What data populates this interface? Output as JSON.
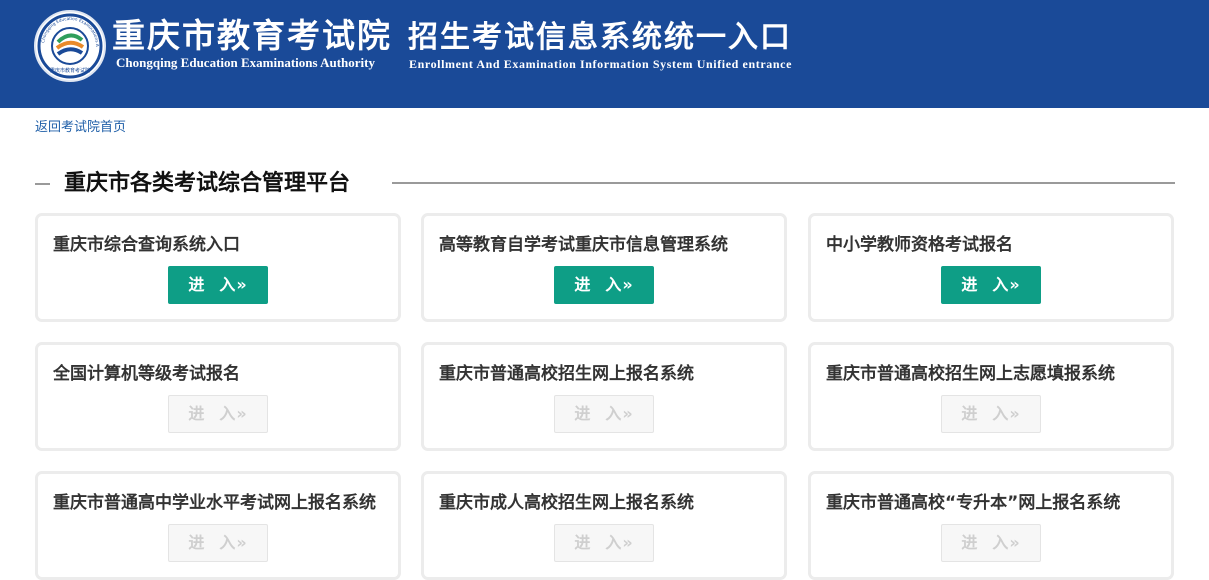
{
  "header": {
    "org_name_cn": "重庆市教育考试院",
    "org_name_en": "Chongqing Education Examinations Authority",
    "system_name_cn": "招生考试信息系统统一入口",
    "system_name_en": "Enrollment And Examination Information System Unified entrance",
    "logo": {
      "ring_text_en": "Chongqing Education Examinations Authority",
      "ring_text_cn": "重庆市教育考试院",
      "colors": {
        "blue": "#1a4a98",
        "green": "#2f9e5b",
        "orange": "#e98a2a"
      }
    }
  },
  "nav": {
    "back_link": "返回考试院首页"
  },
  "section": {
    "title": "重庆市各类考试综合管理平台"
  },
  "button_text": {
    "part1": "进",
    "part2": "入",
    "arrow": "»"
  },
  "cards": [
    {
      "title": "重庆市综合查询系统入口",
      "enabled": true
    },
    {
      "title": "高等教育自学考试重庆市信息管理系统",
      "enabled": true
    },
    {
      "title": "中小学教师资格考试报名",
      "enabled": true
    },
    {
      "title": "全国计算机等级考试报名",
      "enabled": false
    },
    {
      "title": "重庆市普通高校招生网上报名系统",
      "enabled": false
    },
    {
      "title": "重庆市普通高校招生网上志愿填报系统",
      "enabled": false
    },
    {
      "title": "重庆市普通高中学业水平考试网上报名系统",
      "enabled": false
    },
    {
      "title": "重庆市成人高校招生网上报名系统",
      "enabled": false
    },
    {
      "title": "重庆市普通高校“专升本”网上报名系统",
      "enabled": false
    }
  ],
  "colors": {
    "header_bg": "#1a4a98",
    "button_active": "#0e9e86",
    "button_disabled_text": "#cfcfcf",
    "link": "#1f5fa8"
  }
}
